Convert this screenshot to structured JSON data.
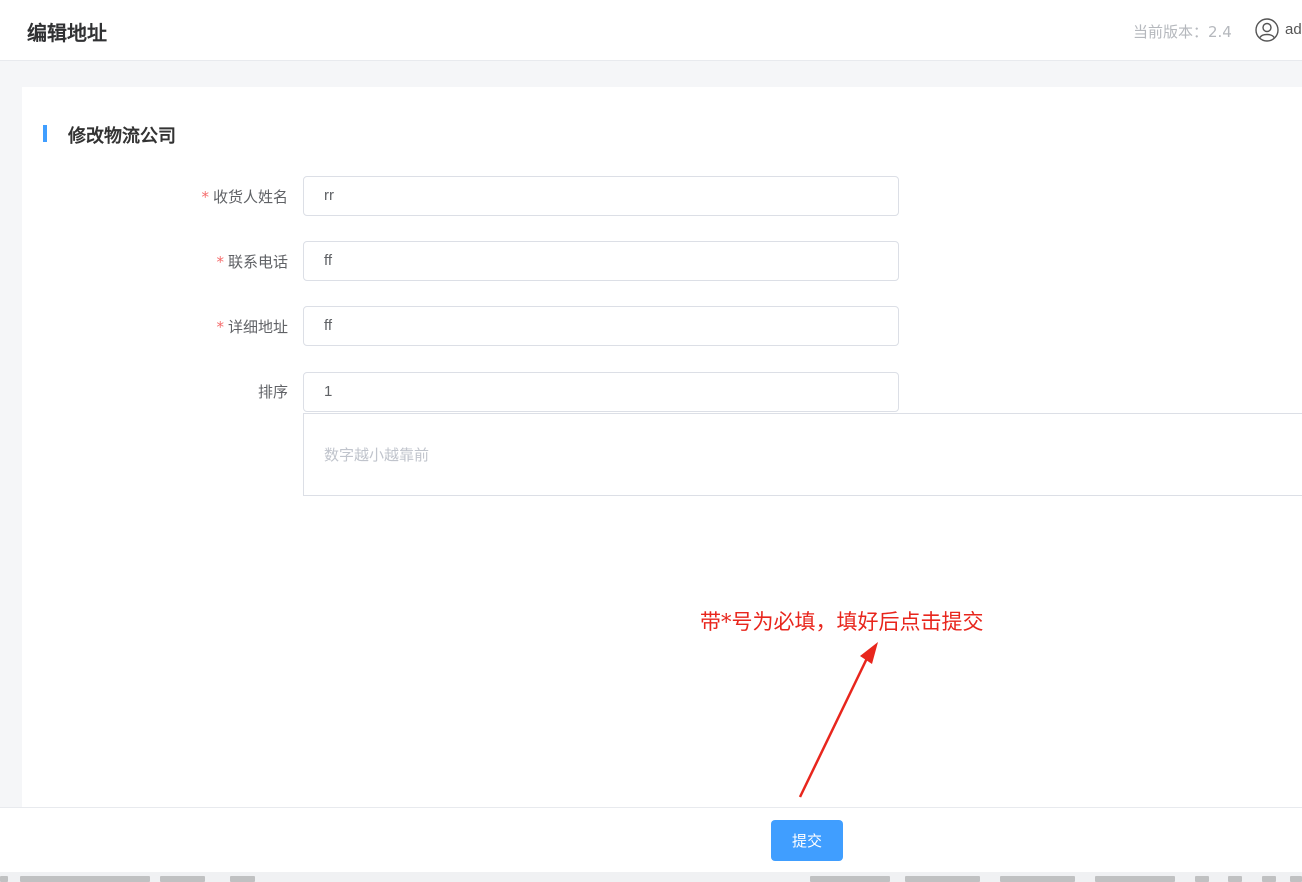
{
  "header": {
    "title": "编辑地址",
    "version_text": "当前版本：2.4",
    "username": "ad"
  },
  "section": {
    "title": "修改物流公司"
  },
  "form": {
    "required_mark": "*",
    "fields": [
      {
        "label": "收货人姓名",
        "required": true,
        "value": "rr"
      },
      {
        "label": "联系电话",
        "required": true,
        "value": "ff"
      },
      {
        "label": "详细地址",
        "required": true,
        "value": "ff"
      },
      {
        "label": "排序",
        "required": false,
        "value": "1"
      }
    ],
    "textarea_placeholder": "数字越小越靠前"
  },
  "annotation": {
    "text": "带*号为必填，填好后点击提交",
    "color": "#e8261d"
  },
  "footer": {
    "submit_label": "提交"
  },
  "colors": {
    "primary": "#409eff",
    "required": "#f56c6c"
  }
}
